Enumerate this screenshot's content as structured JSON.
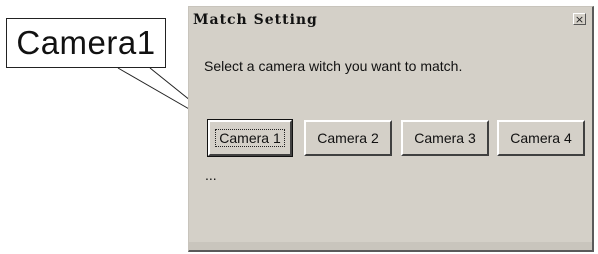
{
  "annotation": {
    "callout_label": "Camera1"
  },
  "dialog": {
    "title": "Match Setting",
    "close_glyph": "×",
    "prompt": "Select a camera witch you want to match.",
    "buttons": [
      {
        "label": "Camera 1"
      },
      {
        "label": "Camera 2"
      },
      {
        "label": "Camera 3"
      },
      {
        "label": "Camera 4"
      }
    ],
    "ellipsis": "..."
  },
  "colors": {
    "dialog_bg": "#d4d0c8",
    "text": "#111111"
  },
  "icons": {
    "close": "close-icon"
  }
}
